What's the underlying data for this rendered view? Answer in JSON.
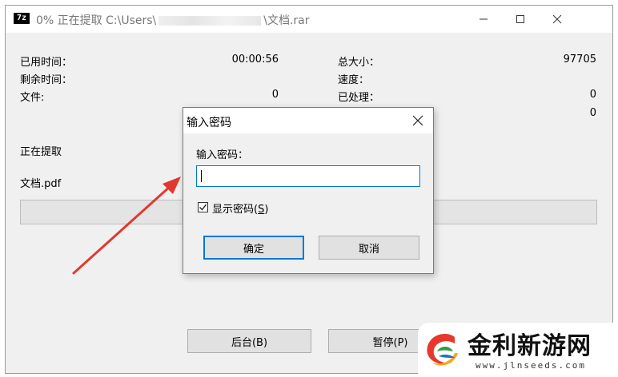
{
  "window": {
    "app_icon_text": "7z",
    "title_prefix": "0% 正在提取 C:\\Users\\",
    "title_suffix": "\\文档.rar"
  },
  "stats": {
    "elapsed_label": "已用时间：",
    "elapsed_value": "00:00:56",
    "remaining_label": "剩余时间：",
    "files_label": "文件:",
    "files_value": "0",
    "total_size_label": "总大小：",
    "total_size_value": "97705",
    "speed_label": "速度：",
    "processed_label": "已处理：",
    "processed_value": "0",
    "compressed_value": "0"
  },
  "status": {
    "action_label": "正在提取",
    "current_file": "文档.pdf"
  },
  "buttons": {
    "background_label": "后台(B)",
    "pause_label": "暂停(P)"
  },
  "password_dialog": {
    "title": "输入密码",
    "prompt_label": "输入密码：",
    "password_value": "",
    "show_password_label": "显示密码(",
    "show_password_key": "S",
    "show_password_end": ")",
    "show_password_checked": true,
    "ok_label": "确定",
    "cancel_label": "取消"
  },
  "watermark": {
    "name": "金利新游网",
    "url": "www.jlnseeds.com"
  },
  "colors": {
    "arrow": "#e03a2f",
    "focus_border": "#0078d7",
    "window_bg": "#f0f0f0"
  }
}
